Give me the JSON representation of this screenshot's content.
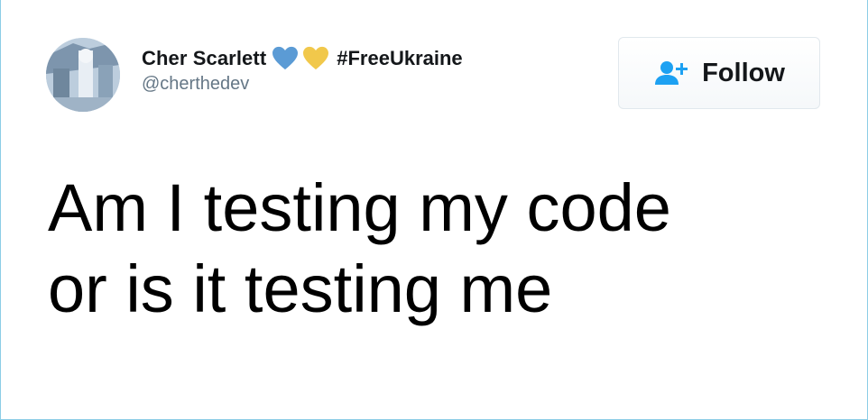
{
  "tweet": {
    "author": {
      "display_name": "Cher Scarlett",
      "name_emojis": [
        "blue-heart-icon",
        "yellow-heart-icon"
      ],
      "hashtag": "#FreeUkraine",
      "handle": "@cherthedev",
      "avatar": "avatar-photo"
    },
    "follow_button": {
      "label": "Follow",
      "icon": "add-user-icon"
    },
    "text_lines": [
      "Am I testing my code",
      "or is it testing me"
    ]
  },
  "colors": {
    "name_text": "#14171a",
    "handle_text": "#657786",
    "tweet_text": "#000000",
    "follow_icon": "#1da1f2",
    "blue_heart": "#5b9bd5",
    "yellow_heart": "#f1c84b",
    "card_border": "#8ccde6"
  }
}
